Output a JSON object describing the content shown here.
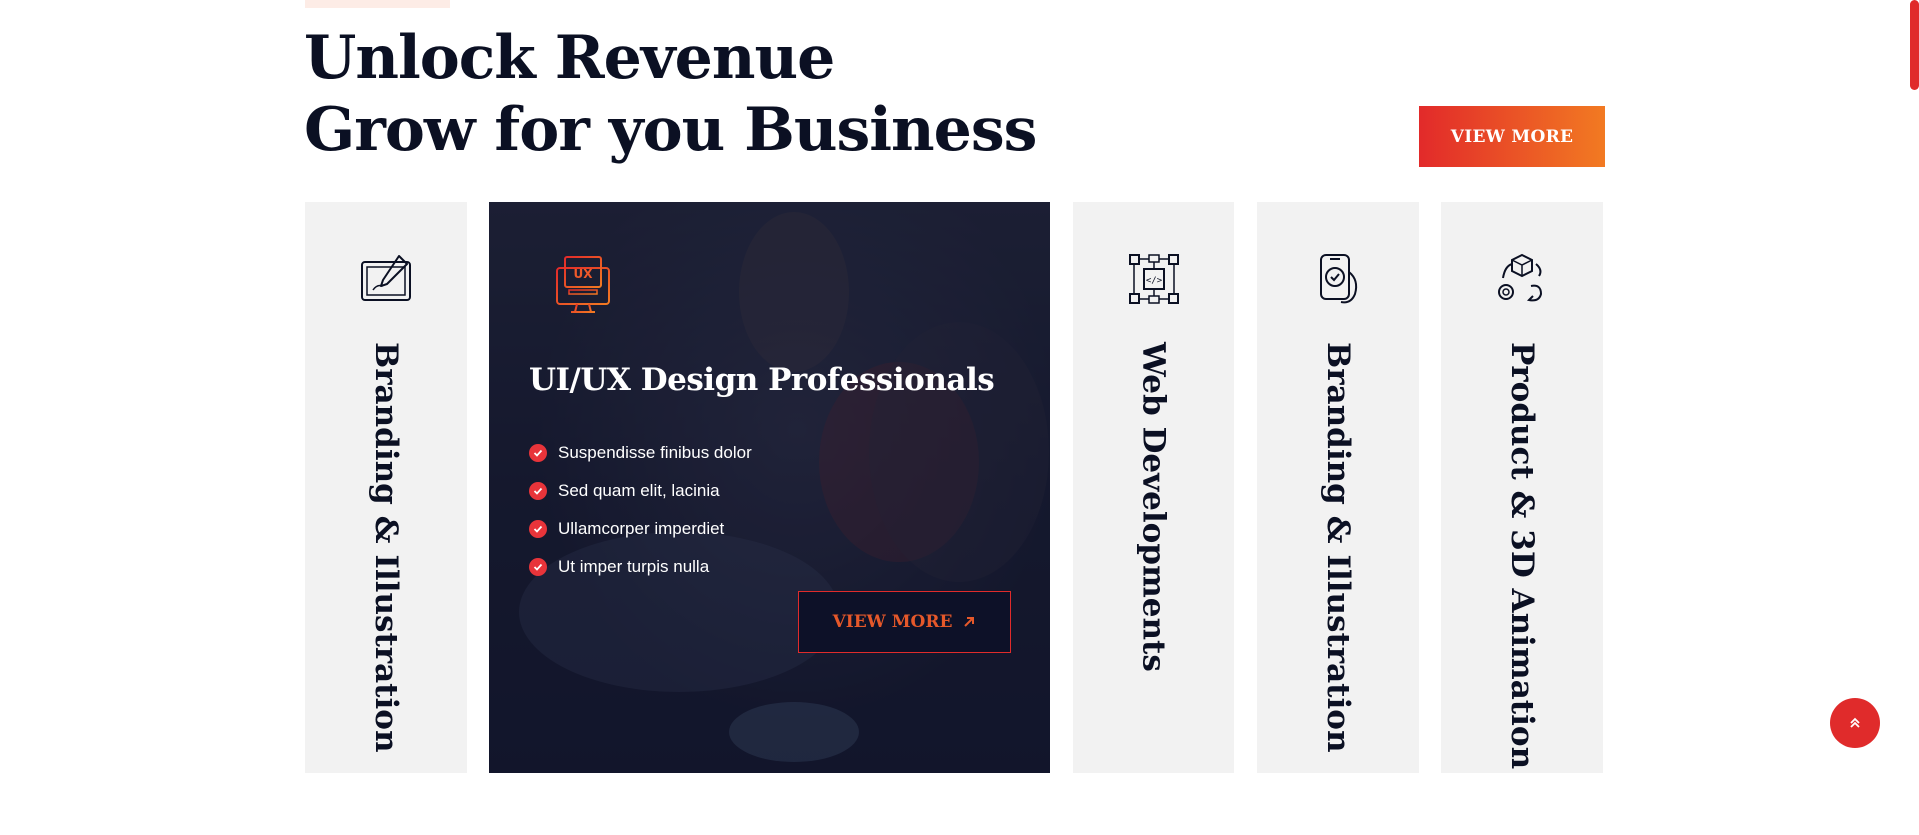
{
  "section": {
    "heading_line1": "Unlock Revenue",
    "heading_line2": "Grow for you Business",
    "view_more_label": "VIEW MORE"
  },
  "services": [
    {
      "label": "Branding & Illustration",
      "icon": "drawing-tablet-icon"
    },
    {
      "label": "Web Developments",
      "icon": "code-network-icon"
    },
    {
      "label": "Branding & Illustration",
      "icon": "phone-check-icon"
    },
    {
      "label": "Product & 3D Animation",
      "icon": "box-cycle-icon"
    }
  ],
  "active_service": {
    "icon": "ux-monitor-icon",
    "icon_text": "UX",
    "title": "UI/UX Design Professionals",
    "features": [
      "Suspendisse finibus dolor",
      "Sed quam elit, lacinia",
      "Ullamcorper imperdiet",
      "Ut imper turpis nulla"
    ],
    "button_label": "VIEW MORE"
  },
  "colors": {
    "accent_red": "#e22a2a",
    "accent_orange": "#f27a22",
    "heading": "#0b1023",
    "card_bg": "#f2f2f2"
  }
}
